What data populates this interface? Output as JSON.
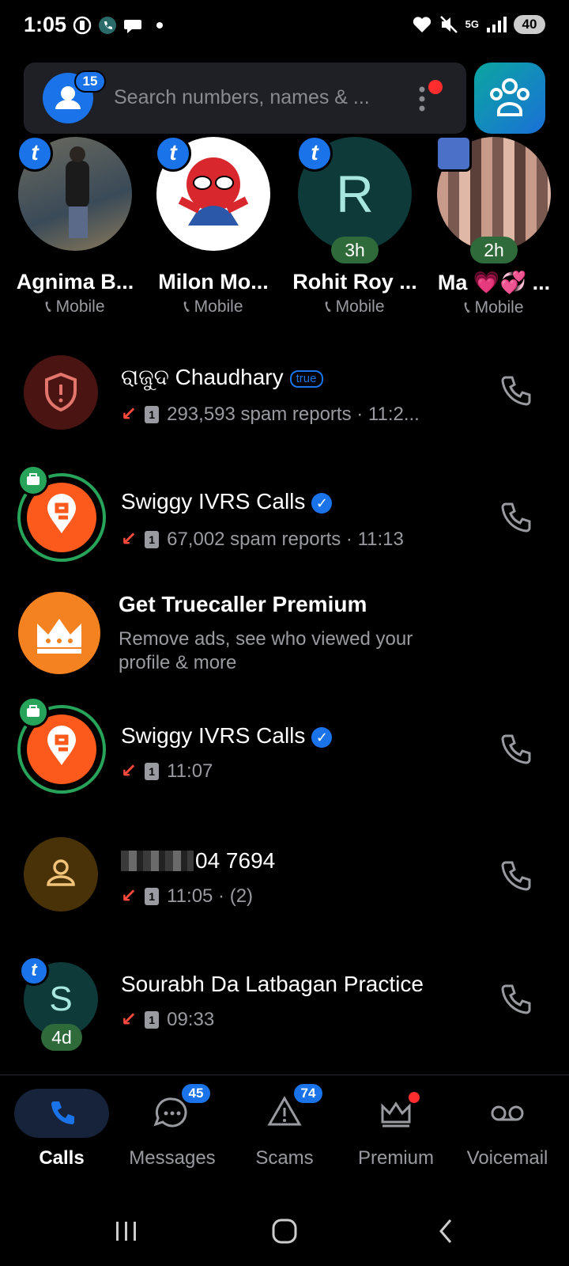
{
  "status_bar": {
    "time": "1:05",
    "battery": "40",
    "network": "5G"
  },
  "search": {
    "contacts_badge": "15",
    "placeholder": "Search numbers, names & ..."
  },
  "favorites": [
    {
      "name": "Agnima B...",
      "sub": "Mobile",
      "time": ""
    },
    {
      "name": "Milon Mo...",
      "sub": "Mobile",
      "time": ""
    },
    {
      "name": "Rohit Roy ...",
      "sub": "Mobile",
      "time": "3h",
      "initial": "R"
    },
    {
      "name": "Ma 💗💞 ...",
      "sub": "Mobile",
      "time": "2h"
    }
  ],
  "calls": [
    {
      "name": "ରାଜୁଦ Chaudhary",
      "tag": "true",
      "meta": "293,593 spam reports · 11:2..."
    },
    {
      "name": "Swiggy IVRS Calls",
      "meta": "67,002 spam reports · 11:13"
    },
    {
      "name": "Swiggy IVRS Calls",
      "meta": "11:07"
    },
    {
      "name": "04 7694",
      "meta": "11:05 · (2)"
    },
    {
      "name": "Sourabh Da Latbagan Practice",
      "meta": "09:33",
      "initial": "S",
      "time": "4d"
    }
  ],
  "promo": {
    "title": "Get Truecaller Premium",
    "line1": "Remove ads, see who viewed your",
    "line2": "profile & more"
  },
  "sim_label": "1",
  "nav": [
    {
      "label": "Calls"
    },
    {
      "label": "Messages",
      "badge": "45"
    },
    {
      "label": "Scams",
      "badge": "74"
    },
    {
      "label": "Premium"
    },
    {
      "label": "Voicemail"
    }
  ],
  "colors": {
    "accent": "#1a73e8",
    "missed": "#ff4a3d",
    "swiggy": "#fc5a1c",
    "premium": "#f58220"
  }
}
